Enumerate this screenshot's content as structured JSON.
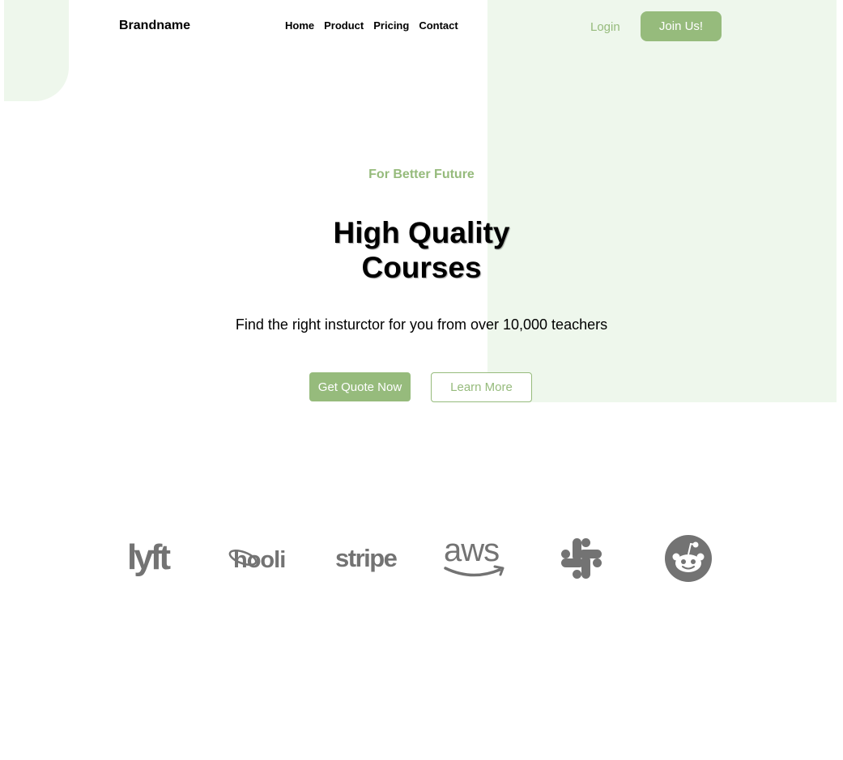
{
  "header": {
    "brand": "Brandname",
    "nav": [
      {
        "label": "Home"
      },
      {
        "label": "Product"
      },
      {
        "label": "Pricing"
      },
      {
        "label": "Contact"
      }
    ],
    "login_label": "Login",
    "join_label": "Join Us!"
  },
  "hero": {
    "eyebrow": "For Better Future",
    "title_line1": "High Quality",
    "title_line2": "Courses",
    "subtitle": "Find the right insturctor for you from over 10,000 teachers",
    "primary_cta": "Get Quote Now",
    "secondary_cta": "Learn More"
  },
  "logos": {
    "lyft_text": "lyft",
    "hooli_text": "hooli",
    "stripe_text": "stripe",
    "aws_text": "aws",
    "icons": [
      "lyft-logo",
      "hooli-logo",
      "stripe-logo",
      "aws-logo",
      "slack-logo",
      "reddit-logo"
    ]
  },
  "colors": {
    "accent": "#96bb7c",
    "accent_light": "#eef7ec",
    "logo_gray": "#737373"
  }
}
